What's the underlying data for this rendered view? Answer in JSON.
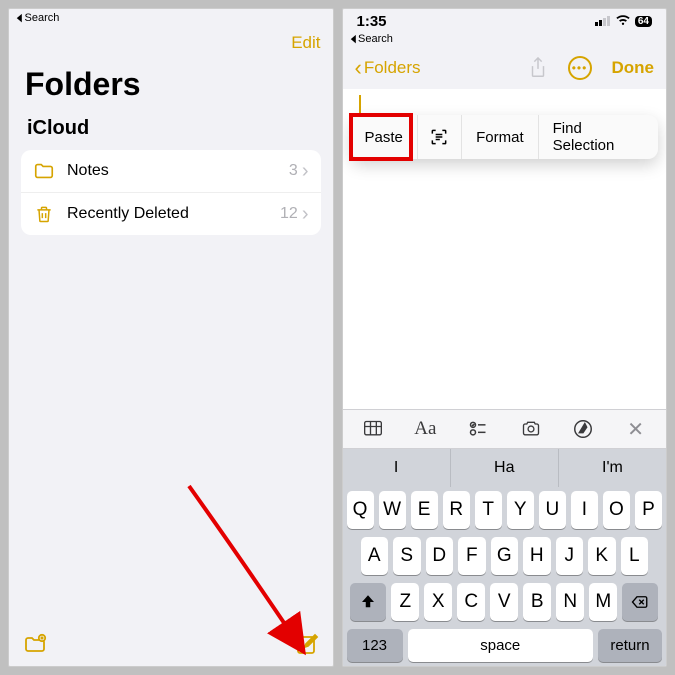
{
  "left": {
    "back_search": "Search",
    "edit": "Edit",
    "title": "Folders",
    "section": "iCloud",
    "rows": [
      {
        "label": "Notes",
        "count": "3"
      },
      {
        "label": "Recently Deleted",
        "count": "12"
      }
    ]
  },
  "right": {
    "time": "1:35",
    "battery": "64",
    "back_search": "Search",
    "back_label": "Folders",
    "done": "Done",
    "menu": {
      "paste": "Paste",
      "format": "Format",
      "find": "Find Selection"
    },
    "tools": {
      "aa": "Aa"
    },
    "suggestions": [
      "I",
      "Ha",
      "I'm"
    ],
    "rows": {
      "r1": [
        "Q",
        "W",
        "E",
        "R",
        "T",
        "Y",
        "U",
        "I",
        "O",
        "P"
      ],
      "r2": [
        "A",
        "S",
        "D",
        "F",
        "G",
        "H",
        "J",
        "K",
        "L"
      ],
      "r3": [
        "Z",
        "X",
        "C",
        "V",
        "B",
        "N",
        "M"
      ]
    },
    "num_key": "123",
    "space_key": "space",
    "return_key": "return"
  }
}
